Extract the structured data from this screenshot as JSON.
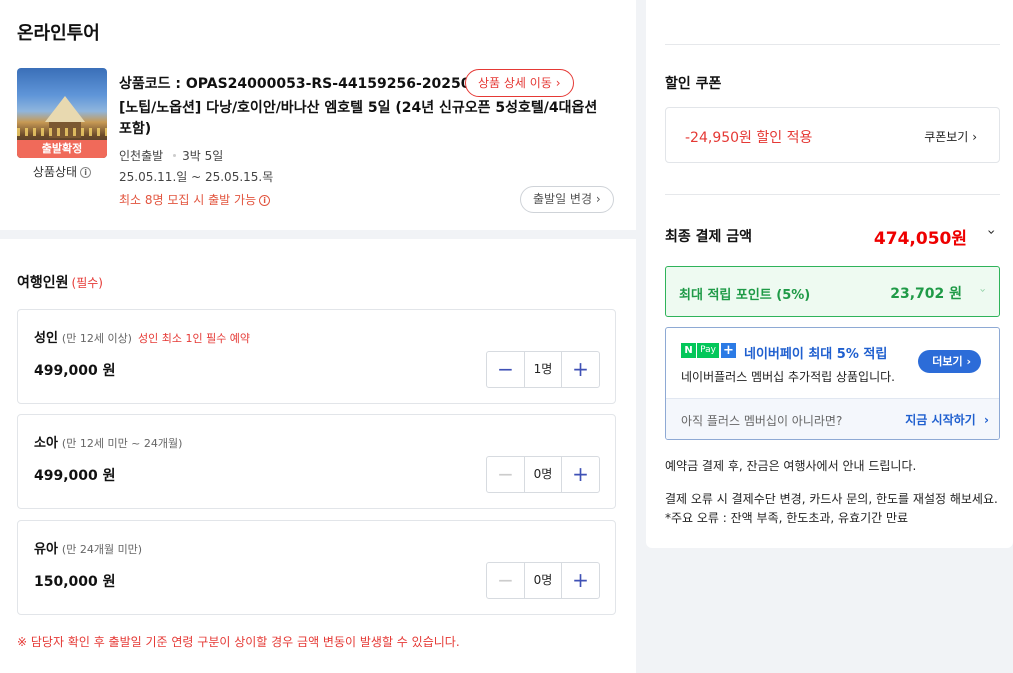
{
  "left": {
    "title": "온라인투어",
    "product": {
      "badge": "출발확정",
      "status_label": "상품상태",
      "code": "상품코드 : OPAS24000053-RS-44159256-20250511",
      "detail_button": "상품 상세 이동",
      "name": "[노팁/노옵션] 다낭/호이안/바나산 엠호텔 5일 (24년 신규오픈 5성호텔/4대옵션 포함)",
      "departure": "인천출발",
      "duration": "3박 5일",
      "dates": "25.05.11.일 ~ 25.05.15.목",
      "min_note": "최소 8명 모집 시 출발 가능",
      "change_date_button": "출발일 변경"
    },
    "travelers": {
      "title": "여행인원",
      "required": "(필수)",
      "items": [
        {
          "label": "성인",
          "sub": "(만 12세 이상)",
          "warn": "성인 최소 1인 필수 예약",
          "price": "499,000 원",
          "count": "1명",
          "minus_enabled": true
        },
        {
          "label": "소아",
          "sub": "(만 12세 미만 ~ 24개월)",
          "warn": "",
          "price": "499,000 원",
          "count": "0명",
          "minus_enabled": false
        },
        {
          "label": "유아",
          "sub": "(만 24개월 미만)",
          "warn": "",
          "price": "150,000 원",
          "count": "0명",
          "minus_enabled": false
        }
      ]
    },
    "notice": "※ 담당자 확인 후 출발일 기준 연령 구분이 상이할 경우 금액 변동이 발생할 수 있습니다."
  },
  "right": {
    "coupon": {
      "title": "할인 쿠폰",
      "amount": "-24,950원 할인 적용",
      "view": "쿠폰보기"
    },
    "final": {
      "label": "최종 결제 금액",
      "amount": "474,050원"
    },
    "points": {
      "label": "최대 적립 포인트 (5%)",
      "value": "23,702 원"
    },
    "npay": {
      "logo_n": "N",
      "logo_pay": "Pay",
      "logo_plus": "+",
      "title": "네이버페이 최대 5% 적립",
      "desc": "네이버플러스 멤버십 추가적립 상품입니다.",
      "more": "더보기",
      "question": "아직 플러스 멤버십이 아니라면?",
      "start": "지금 시작하기"
    },
    "notes": [
      "예약금 결제 후, 잔금은 여행사에서 안내 드립니다.",
      "결제 오류 시 결제수단 변경, 카드사 문의, 한도를 재설정 해보세요.",
      "*주요 오류 : 잔액 부족, 한도초과, 유효기간 만료"
    ]
  },
  "colors": {
    "accent_red": "#e53935",
    "point_green": "#1f9a47",
    "npay_blue": "#2c6cd8"
  },
  "icons": {
    "info": "info-circle-icon",
    "chevron": "chevron-right-icon",
    "minus": "minus-icon",
    "plus": "plus-icon"
  }
}
